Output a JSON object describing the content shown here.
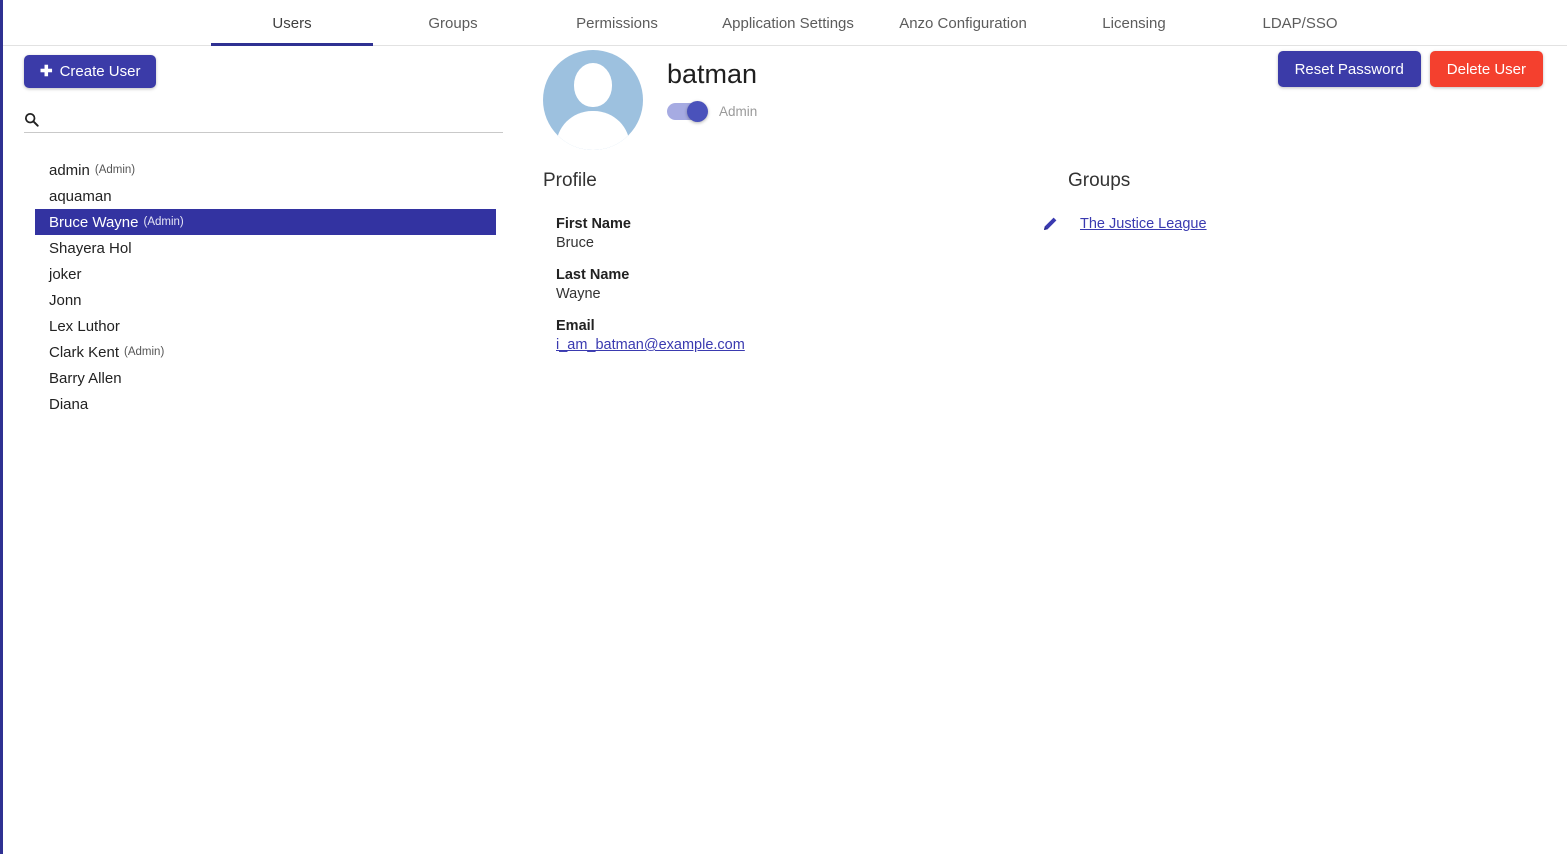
{
  "tabs": [
    {
      "label": "Users",
      "active": true
    },
    {
      "label": "Groups",
      "active": false
    },
    {
      "label": "Permissions",
      "active": false
    },
    {
      "label": "Application Settings",
      "active": false
    },
    {
      "label": "Anzo Configuration",
      "active": false
    },
    {
      "label": "Licensing",
      "active": false
    },
    {
      "label": "LDAP/SSO",
      "active": false
    }
  ],
  "sidebar": {
    "create_user_label": "Create User",
    "plus_icon": "plus-icon",
    "search": {
      "icon": "search-icon",
      "value": "",
      "placeholder": ""
    },
    "users": [
      {
        "name": "admin",
        "tag": "(Admin)",
        "selected": false
      },
      {
        "name": "aquaman",
        "tag": "",
        "selected": false
      },
      {
        "name": "Bruce Wayne",
        "tag": "(Admin)",
        "selected": true
      },
      {
        "name": "Shayera Hol",
        "tag": "",
        "selected": false
      },
      {
        "name": "joker",
        "tag": "",
        "selected": false
      },
      {
        "name": "Jonn",
        "tag": "",
        "selected": false
      },
      {
        "name": "Lex Luthor",
        "tag": "",
        "selected": false
      },
      {
        "name": "Clark Kent",
        "tag": "(Admin)",
        "selected": false
      },
      {
        "name": "Barry Allen",
        "tag": "",
        "selected": false
      },
      {
        "name": "Diana",
        "tag": "",
        "selected": false
      }
    ]
  },
  "detail": {
    "username": "batman",
    "avatar_icon": "user-avatar-icon",
    "admin_toggle": {
      "label": "Admin",
      "enabled": true
    },
    "actions": {
      "reset_password_label": "Reset Password",
      "delete_user_label": "Delete User"
    },
    "profile": {
      "title": "Profile",
      "edit_icon": "pencil-icon",
      "fields": [
        {
          "label": "First Name",
          "value": "Bruce",
          "is_link": false
        },
        {
          "label": "Last Name",
          "value": "Wayne",
          "is_link": false
        },
        {
          "label": "Email",
          "value": "i_am_batman@example.com",
          "is_link": true
        }
      ]
    },
    "groups": {
      "title": "Groups",
      "items": [
        {
          "label": "The Justice League"
        }
      ]
    }
  },
  "colors": {
    "primary": "#3b3ba8",
    "selection": "#3333a1",
    "danger": "#f4402e",
    "link": "#3a3ab0",
    "avatar_bg": "#9dc1df",
    "toggle_track": "#a6abe2",
    "toggle_knob": "#4a52bb",
    "left_border": "#2f3192"
  }
}
